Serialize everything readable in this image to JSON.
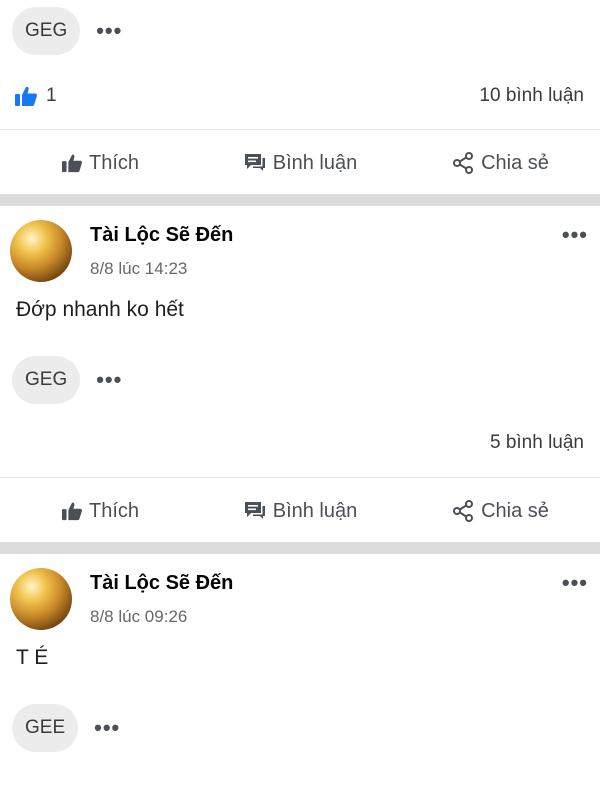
{
  "top_post": {
    "reaction_chip": "GEG",
    "more": "•••",
    "like_count": "1",
    "comment_count": "10 bình luận",
    "actions": {
      "like": "Thích",
      "comment": "Bình luận",
      "share": "Chia sẻ"
    }
  },
  "posts": [
    {
      "author": "Tài Lộc Sẽ Đến",
      "time": "8/8 lúc 14:23",
      "more": "•••",
      "text": "Đớp nhanh ko hết",
      "reaction_chip": "GEG",
      "chip_more": "•••",
      "comment_count": "5 bình luận",
      "actions": {
        "like": "Thích",
        "comment": "Bình luận",
        "share": "Chia sẻ"
      }
    },
    {
      "author": "Tài Lộc Sẽ Đến",
      "time": "8/8 lúc 09:26",
      "more": "•••",
      "text": "T É",
      "reaction_chip": "GEE",
      "chip_more": "•••"
    }
  ],
  "colors": {
    "like_blue": "#1877f2",
    "separator": "#dcdcdc",
    "icon_gray": "#4b4f56"
  }
}
